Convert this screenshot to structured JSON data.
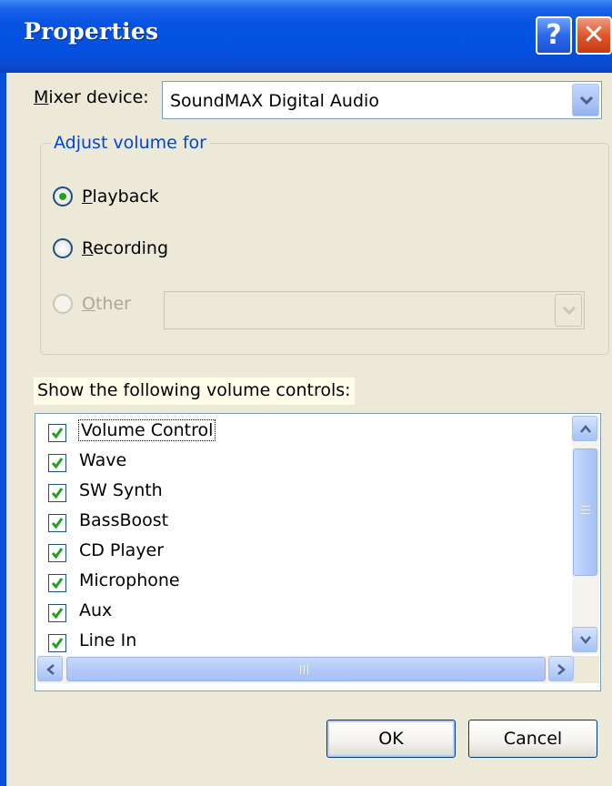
{
  "window": {
    "title": "Properties",
    "help_button": "?",
    "close_button": "✕"
  },
  "mixer": {
    "label_prefix": "M",
    "label_rest": "ixer device:",
    "selected": "SoundMAX Digital Audio"
  },
  "adjust": {
    "legend": "Adjust volume for",
    "options": [
      {
        "accel": "P",
        "rest": "layback",
        "checked": true,
        "enabled": true
      },
      {
        "accel": "R",
        "rest": "ecording",
        "checked": false,
        "enabled": true
      },
      {
        "accel": "O",
        "rest": "ther",
        "checked": false,
        "enabled": false
      }
    ],
    "other_selected": ""
  },
  "controls": {
    "label": "Show the following volume controls:",
    "items": [
      {
        "label": "Volume Control",
        "checked": true
      },
      {
        "label": "Wave",
        "checked": true
      },
      {
        "label": "SW Synth",
        "checked": true
      },
      {
        "label": "BassBoost",
        "checked": true
      },
      {
        "label": "CD Player",
        "checked": true
      },
      {
        "label": "Microphone",
        "checked": true
      },
      {
        "label": "Aux",
        "checked": true
      },
      {
        "label": "Line In",
        "checked": true
      }
    ]
  },
  "buttons": {
    "ok": "OK",
    "cancel": "Cancel"
  },
  "colors": {
    "titlebar": "#0450df",
    "dialog_bg": "#ece9d8",
    "group_legend": "#0046d5",
    "checkmark": "#21a121"
  }
}
